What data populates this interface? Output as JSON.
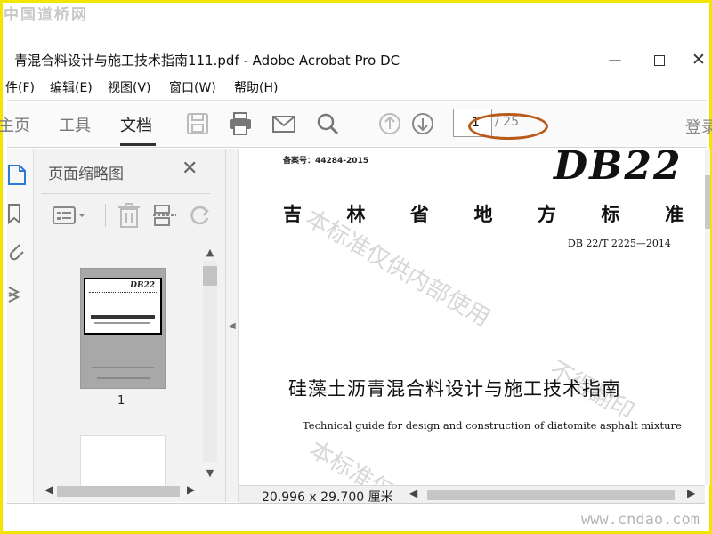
{
  "site": {
    "logo": "中国道桥网",
    "url": "www.cndao.com"
  },
  "window": {
    "title": "青混合料设计与施工技术指南111.pdf - Adobe Acrobat Pro DC",
    "minimize": "—",
    "close": "✕"
  },
  "menu": [
    {
      "label": "件(F)"
    },
    {
      "label": "编辑(E)"
    },
    {
      "label": "视图(V)"
    },
    {
      "label": "窗口(W)"
    },
    {
      "label": "帮助(H)"
    }
  ],
  "toolbar": {
    "tabs": [
      {
        "label": "主页"
      },
      {
        "label": "工具"
      },
      {
        "label": "文档"
      }
    ],
    "active_tab": "文档",
    "page_current": "1",
    "page_total": "/ 25",
    "login": "登录"
  },
  "thumbnails_panel": {
    "title": "页面缩略图",
    "close": "✕",
    "page_label": "1",
    "thumb_code": "DB22"
  },
  "document": {
    "record_no": "备案号：44284-2015",
    "code": "DB22",
    "province_chars": [
      "吉",
      "林",
      "省",
      "地",
      "方",
      "标",
      "准"
    ],
    "standard_no": "DB 22/T 2225—2014",
    "title_zh": "硅藻土沥青混合料设计与施工技术指南",
    "title_en": "Technical guide for design and construction of diatomite asphalt mixture",
    "watermark_1": "本标准仅供内部使用",
    "watermark_2": "不得翻印",
    "watermark_3": "本标准仅"
  },
  "status": {
    "page_size": "20.996 x 29.700 厘米"
  },
  "colors": {
    "frame": "#f2e600",
    "highlight_ellipse": "#b85a1a"
  }
}
